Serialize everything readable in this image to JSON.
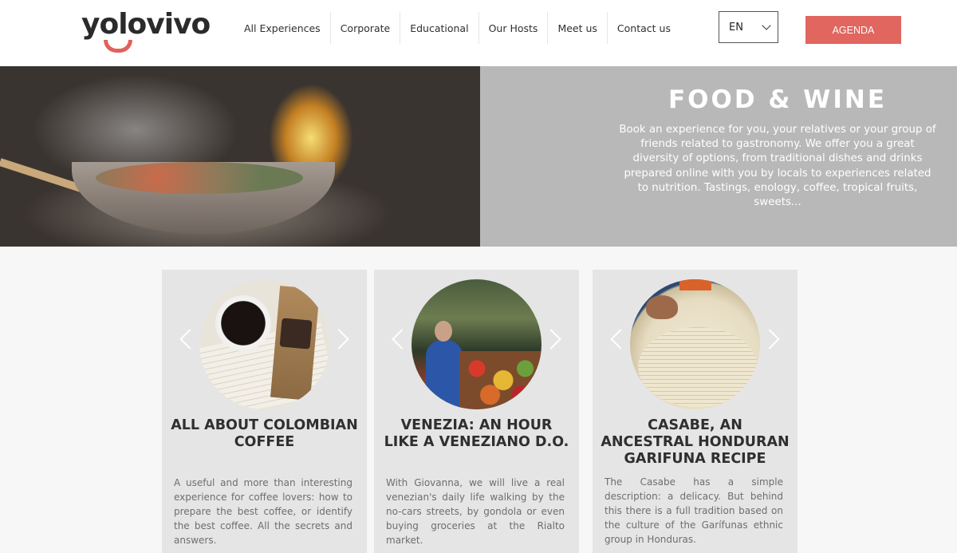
{
  "header": {
    "logo_text": "yolovivo",
    "nav": [
      {
        "label": "All Experiences"
      },
      {
        "label": "Corporate"
      },
      {
        "label": "Educational"
      },
      {
        "label": "Our Hosts"
      },
      {
        "label": "Meet us"
      },
      {
        "label": "Contact us"
      }
    ],
    "language": "EN",
    "agenda_label": "AGENDA",
    "accent_color": "#e0665f"
  },
  "hero": {
    "title": "FOOD & WINE",
    "description": "Book an experience for you, your relatives or your group of friends related to gastronomy. We offer you a great diversity of options, from traditional dishes and drinks prepared online with you by locals to experiences related to nutrition. Tastings, enology, coffee, tropical fruits, sweets..."
  },
  "cards": [
    {
      "title": "ALL ABOUT COLOMBIAN COFFEE",
      "description": "A useful and more than interesting experience for coffee lovers: how to prepare the best coffee, or identify the best coffee. All the secrets and answers.",
      "image_icon": "coffee-image"
    },
    {
      "title": "VENEZIA: AN HOUR LIKE A VENEZIANO D.O.",
      "description": "With Giovanna, we will live a real venezian's daily life walking by the no-cars streets, by gondola or even buying groceries at the Rialto market.",
      "image_icon": "market-image"
    },
    {
      "title": "CASABE, AN ANCESTRAL HONDURAN GARIFUNA RECIPE",
      "description": "The Casabe has a simple description: a delicacy. But behind this there is a full tradition based on the culture of the Garífunas ethnic group in Honduras.",
      "image_icon": "casabe-image"
    }
  ]
}
